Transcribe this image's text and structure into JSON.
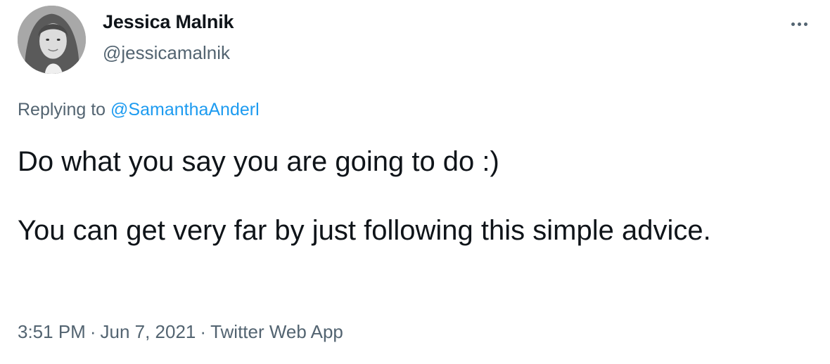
{
  "author": {
    "name": "Jessica Malnik",
    "handle": "@jessicamalnik"
  },
  "reply": {
    "prefix": "Replying to",
    "mention": "@SamanthaAnderl"
  },
  "tweet": {
    "line1": "Do what you say you are going to do :)",
    "line2": "You can get very far by just following this simple advice."
  },
  "meta": {
    "time": "3:51 PM",
    "separator": "·",
    "date": "Jun 7, 2021",
    "source": "Twitter Web App"
  },
  "icons": {
    "more": "more-horizontal-icon"
  },
  "colors": {
    "text": "#0f1419",
    "secondary": "#536471",
    "link": "#1d9bf0"
  }
}
